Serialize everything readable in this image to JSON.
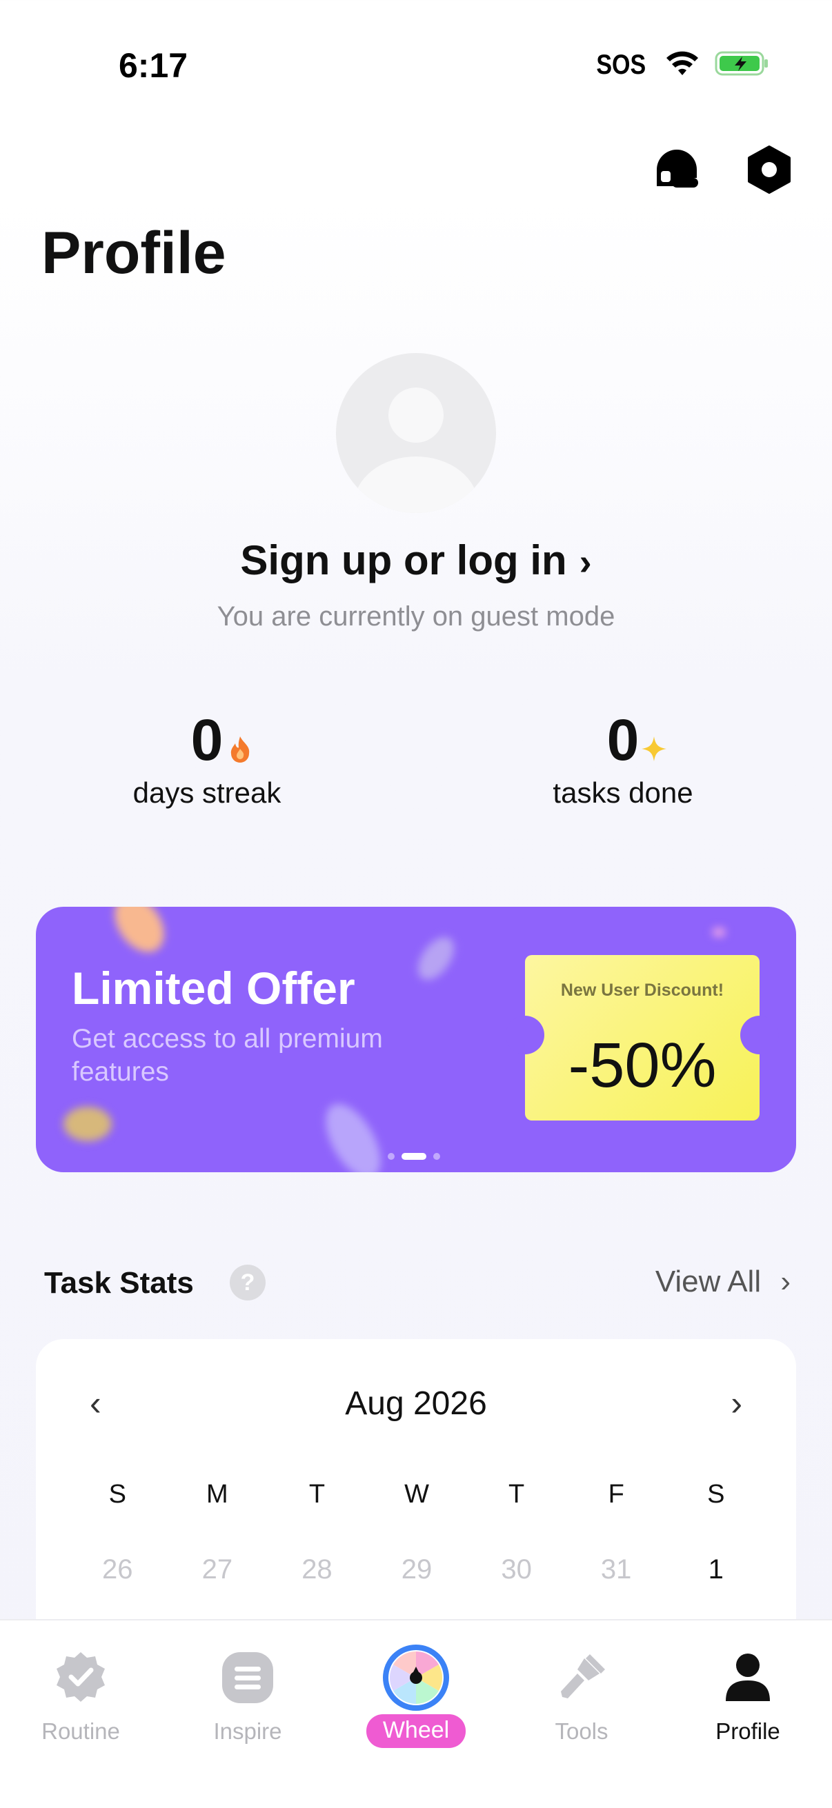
{
  "status_bar": {
    "time": "6:17",
    "sos": "SOS"
  },
  "header": {
    "title": "Profile",
    "support_icon": "headset-icon",
    "settings_icon": "hexagon-settings-icon"
  },
  "account": {
    "signup_label": "Sign up or log in",
    "chevron": "›",
    "guest_note": "You are currently on guest mode"
  },
  "stats": [
    {
      "value": "0",
      "label": "days streak",
      "icon": "flame-icon"
    },
    {
      "value": "0",
      "label": "tasks done",
      "icon": "sparkle-icon"
    }
  ],
  "promo": {
    "title": "Limited Offer",
    "subtitle": "Get access to all premium features",
    "coupon_caption": "New User Discount!",
    "coupon_value": "-50%",
    "background_color": "#8f63fb",
    "coupon_color": "#f7f258",
    "page_dots": 3,
    "active_dot": 2
  },
  "task_stats": {
    "title": "Task Stats",
    "help": "?",
    "view_all": "View All",
    "view_all_chevron": "›",
    "calendar": {
      "month": "Aug 2026",
      "prev": "‹",
      "next": "›",
      "weekdays": [
        "S",
        "M",
        "T",
        "W",
        "T",
        "F",
        "S"
      ],
      "first_row": [
        "26",
        "27",
        "28",
        "29",
        "30",
        "31",
        "1"
      ]
    }
  },
  "bottom_nav": {
    "items": [
      {
        "label": "Routine",
        "icon": "check-badge-icon"
      },
      {
        "label": "Inspire",
        "icon": "list-icon"
      },
      {
        "label": "Wheel",
        "icon": "spin-wheel-icon"
      },
      {
        "label": "Tools",
        "icon": "brush-icon"
      },
      {
        "label": "Profile",
        "icon": "person-icon"
      }
    ],
    "active": "Profile",
    "wheel_highlight_color": "#ef5bd2"
  }
}
